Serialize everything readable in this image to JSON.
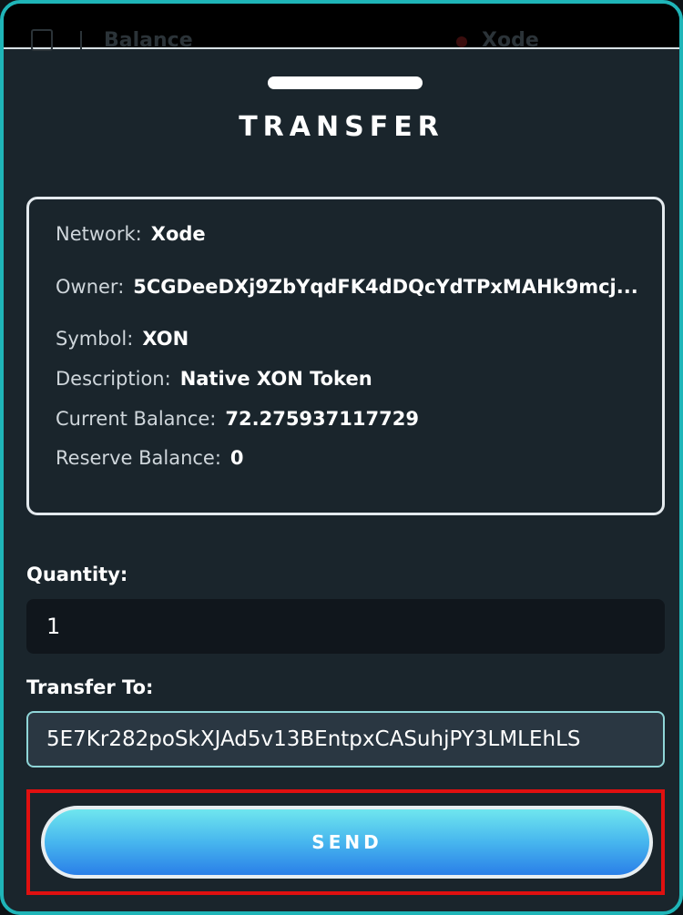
{
  "topbar": {
    "title": "Balance",
    "network": "Xode",
    "network_dot_color": "#3a0d0d"
  },
  "modal": {
    "title": "TRANSFER",
    "accent_color": "#1fb5b8"
  },
  "token_info": {
    "network_label": "Network:",
    "network_value": "Xode",
    "owner_label": "Owner:",
    "owner_value": "5CGDeeDXj9ZbYqdFK4dDQcYdTPxMAHk9mcj...",
    "symbol_label": "Symbol:",
    "symbol_value": "XON",
    "description_label": "Description:",
    "description_value": "Native XON Token",
    "current_balance_label": "Current Balance:",
    "current_balance_value": "72.275937117729",
    "reserve_balance_label": "Reserve Balance:",
    "reserve_balance_value": "0"
  },
  "form": {
    "quantity_label": "Quantity:",
    "quantity_value": "1",
    "transfer_to_label": "Transfer To:",
    "transfer_to_value": "5E7Kr282poSkXJAd5v13BEntpxCASuhjPY3LMLEhLS"
  },
  "actions": {
    "send_label": "SEND",
    "highlight_color": "#e01010"
  }
}
